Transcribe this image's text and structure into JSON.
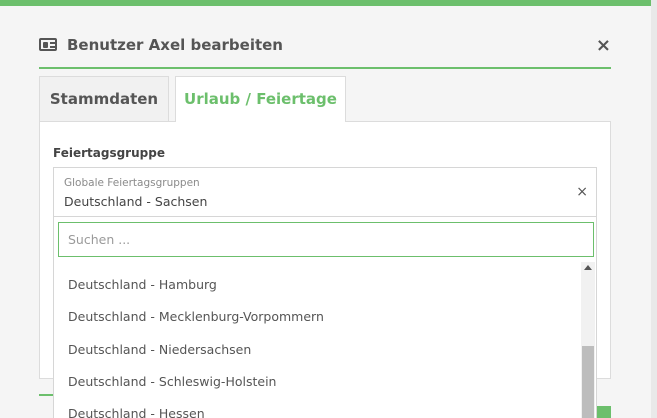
{
  "dialog": {
    "title": "Benutzer Axel bearbeiten",
    "icon": "id-card-icon",
    "close_symbol": "×"
  },
  "tabs": [
    {
      "label": "Stammdaten",
      "active": false
    },
    {
      "label": "Urlaub / Feiertage",
      "active": true
    }
  ],
  "form": {
    "field_label": "Feiertagsgruppe",
    "select": {
      "group_label": "Globale Feiertagsgruppen",
      "value": "Deutschland - Sachsen",
      "clear_symbol": "×"
    },
    "dropdown": {
      "search_placeholder": "Suchen ...",
      "options": [
        "Deutschland - Hamburg",
        "Deutschland - Mecklenburg-Vorpommern",
        "Deutschland - Niedersachsen",
        "Deutschland - Schleswig-Holstein",
        "Deutschland - Hessen"
      ]
    }
  },
  "colors": {
    "accent": "#6cbf6c",
    "text": "#444444"
  }
}
